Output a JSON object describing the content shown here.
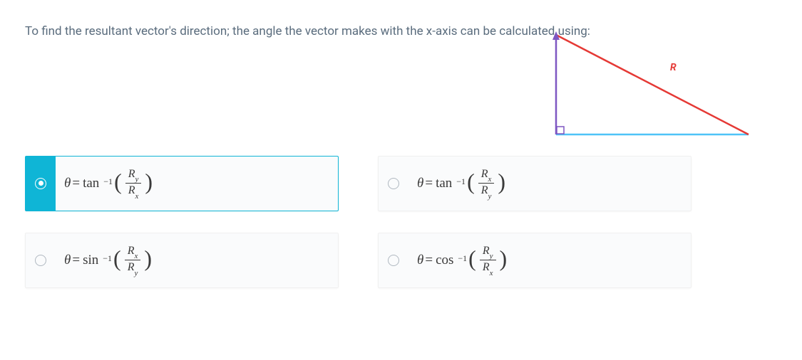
{
  "question": "To find the resultant vector's direction; the angle the vector makes with the x-axis can be calculated using:",
  "triangle": {
    "label": "R",
    "label_color": "#e53935"
  },
  "options": {
    "a": {
      "func": "tan",
      "num_base": "R",
      "num_sub": "y",
      "den_base": "R",
      "den_sub": "x",
      "selected": true
    },
    "b": {
      "func": "tan",
      "num_base": "R",
      "num_sub": "x",
      "den_base": "R",
      "den_sub": "y",
      "selected": false
    },
    "c": {
      "func": "sin",
      "num_base": "R",
      "num_sub": "x",
      "den_base": "R",
      "den_sub": "y",
      "selected": false
    },
    "d": {
      "func": "cos",
      "num_base": "R",
      "num_sub": "y",
      "den_base": "R",
      "den_sub": "x",
      "selected": false
    }
  },
  "symbols": {
    "theta": "θ",
    "equals": " = ",
    "inverse": "−1"
  }
}
